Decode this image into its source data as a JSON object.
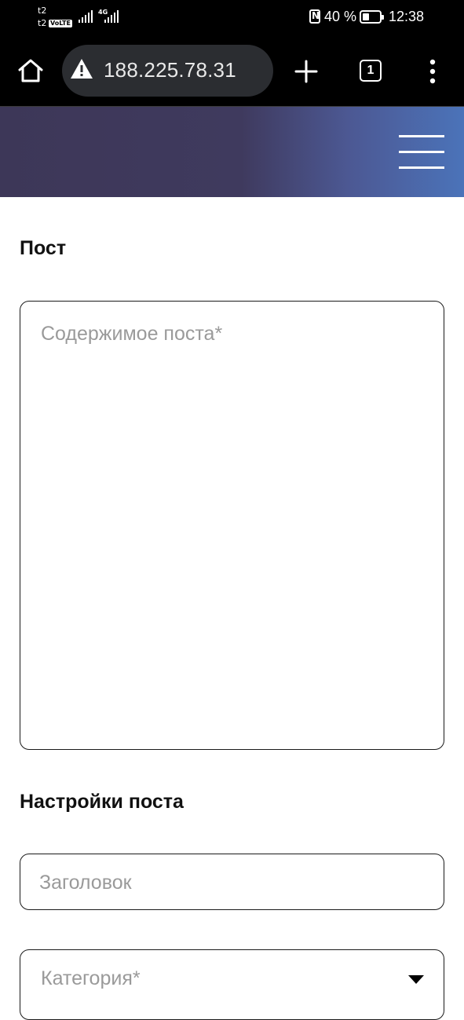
{
  "status_bar": {
    "carrier_1": "t2",
    "carrier_2": "t2",
    "volte_badge": "VoLTE",
    "network_type": "4G",
    "battery_percent": "40 %",
    "battery_level": 0.4,
    "time": "12:38"
  },
  "browser": {
    "url": "188.225.78.31",
    "tab_count": "1",
    "icons": {
      "home": "home-icon",
      "security_warning": "warning-icon",
      "new_tab": "plus-icon",
      "tabs": "tab-switcher-icon",
      "menu": "more-vert-icon"
    }
  },
  "site_header": {
    "menu_icon": "hamburger-icon",
    "gradient_colors": [
      "#3d3758",
      "#4b73b9"
    ]
  },
  "post_section": {
    "title": "Пост",
    "content_placeholder": "Содержимое поста*"
  },
  "settings_section": {
    "title": "Настройки поста",
    "title_placeholder": "Заголовок",
    "category_placeholder": "Категория*",
    "category_dropdown_icon": "caret-down-icon"
  }
}
